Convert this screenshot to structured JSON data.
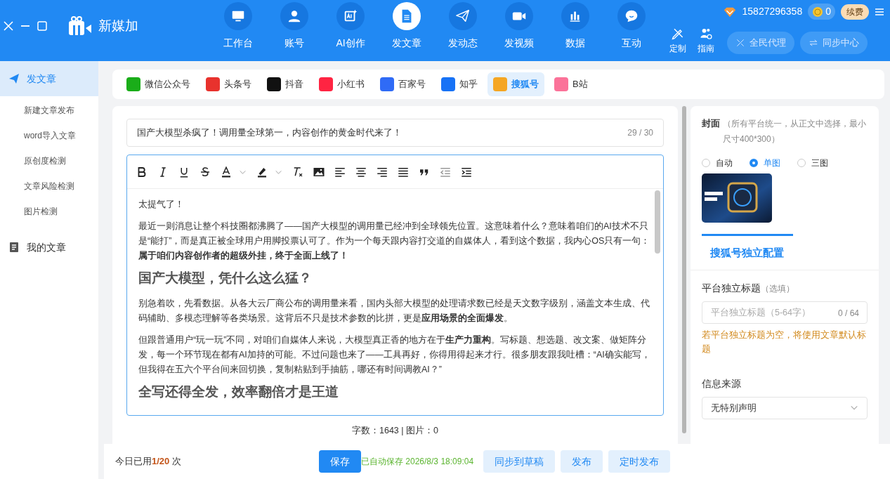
{
  "app": {
    "name": "新媒加"
  },
  "nav": [
    {
      "label": "工作台",
      "selected": false
    },
    {
      "label": "账号",
      "selected": false
    },
    {
      "label": "AI创作",
      "selected": false
    },
    {
      "label": "发文章",
      "selected": true
    },
    {
      "label": "发动态",
      "selected": false
    },
    {
      "label": "发视频",
      "selected": false
    },
    {
      "label": "数据",
      "selected": false
    },
    {
      "label": "互动",
      "selected": false
    }
  ],
  "tools": [
    {
      "label": "定制"
    },
    {
      "label": "指南"
    }
  ],
  "account": {
    "phone": "15827296358",
    "coins": "0",
    "renew": "续费"
  },
  "header_buttons": [
    {
      "label": "全民代理"
    },
    {
      "label": "同步中心"
    }
  ],
  "sidebar": {
    "sections": [
      {
        "label": "发文章",
        "selected": true,
        "items": [
          {
            "label": "新建文章发布"
          },
          {
            "label": "word导入文章"
          },
          {
            "label": "原创度检测"
          },
          {
            "label": "文章风险检测"
          },
          {
            "label": "图片检测"
          }
        ]
      },
      {
        "label": "我的文章",
        "selected": false
      }
    ]
  },
  "platforms": [
    {
      "label": "微信公众号",
      "selected": false,
      "color": "#1aad19"
    },
    {
      "label": "头条号",
      "selected": false,
      "color": "#e8322d"
    },
    {
      "label": "抖音",
      "selected": false,
      "color": "#111111"
    },
    {
      "label": "小红书",
      "selected": false,
      "color": "#ff2442"
    },
    {
      "label": "百家号",
      "selected": false,
      "color": "#2f6bf6"
    },
    {
      "label": "知乎",
      "selected": false,
      "color": "#1772f6"
    },
    {
      "label": "搜狐号",
      "selected": true,
      "color": "#f5a623"
    },
    {
      "label": "B站",
      "selected": false,
      "color": "#fb7299"
    }
  ],
  "article": {
    "title": "国产大模型杀疯了！调用量全球第一，内容创作的黄金时代来了！",
    "title_counter": "29 / 30",
    "blocks": [
      {
        "kind": "paragraph",
        "text": "太提气了！"
      },
      {
        "kind": "paragraph",
        "text": "最近一则消息让整个科技圈都沸腾了——国产大模型的调用量已经冲到全球领先位置。这意味着什么？意味着咱们的AI技术不只是“能打”，而是真正被全球用户用脚投票认可了。作为一个每天跟内容打交道的自媒体人，看到这个数据，我内心OS只有一句：**属于咱们内容创作者的超级外挂，终于全面上线了！**"
      },
      {
        "kind": "heading",
        "text": "国产大模型，凭什么这么猛？"
      },
      {
        "kind": "paragraph",
        "text": "别急着吹，先看数据。从各大云厂商公布的调用量来看，国内头部大模型的处理请求数已经是天文数字级别，涵盖文本生成、代码辅助、多模态理解等各类场景。这背后不只是技术参数的比拼，更是**应用场景的全面爆发**。"
      },
      {
        "kind": "paragraph",
        "text": "但跟普通用户“玩一玩”不同，对咱们自媒体人来说，大模型真正香的地方在于**生产力重构**。写标题、想选题、改文案、做矩阵分发，每一个环节现在都有AI加持的可能。不过问题也来了——工具再好，你得用得起来才行。很多朋友跟我吐槽：“AI确实能写，但我得在五六个平台间来回切换，复制粘贴到手抽筋，哪还有时间调教AI？”"
      },
      {
        "kind": "heading",
        "text": "全写还得全发，效率翻倍才是王道"
      }
    ],
    "word_count": "字数：1643 | 图片：0"
  },
  "settings": {
    "cover_label": "封面",
    "cover_hint": "（所有平台统一，从正文中选择，最小尺寸400*300）",
    "cover_modes": [
      {
        "label": "自动",
        "selected": false
      },
      {
        "label": "单图",
        "selected": true
      },
      {
        "label": "三图",
        "selected": false
      }
    ],
    "config_tab": "搜狐号独立配置",
    "title_label": "平台独立标题",
    "title_optional": "（选填）",
    "title_placeholder": "平台独立标题（5-64字）",
    "title_counter": "0 / 64",
    "title_warning": "若平台独立标题为空，将使用文章默认标题",
    "source_label": "信息来源",
    "source_value": "无特别声明"
  },
  "footer": {
    "usage": "今日已用**1/20** 次",
    "save": "保存",
    "autosave": "已自动保存 2026/8/3 18:09:04",
    "buttons": [
      {
        "label": "同步到草稿"
      },
      {
        "label": "发布"
      },
      {
        "label": "定时发布"
      }
    ]
  }
}
